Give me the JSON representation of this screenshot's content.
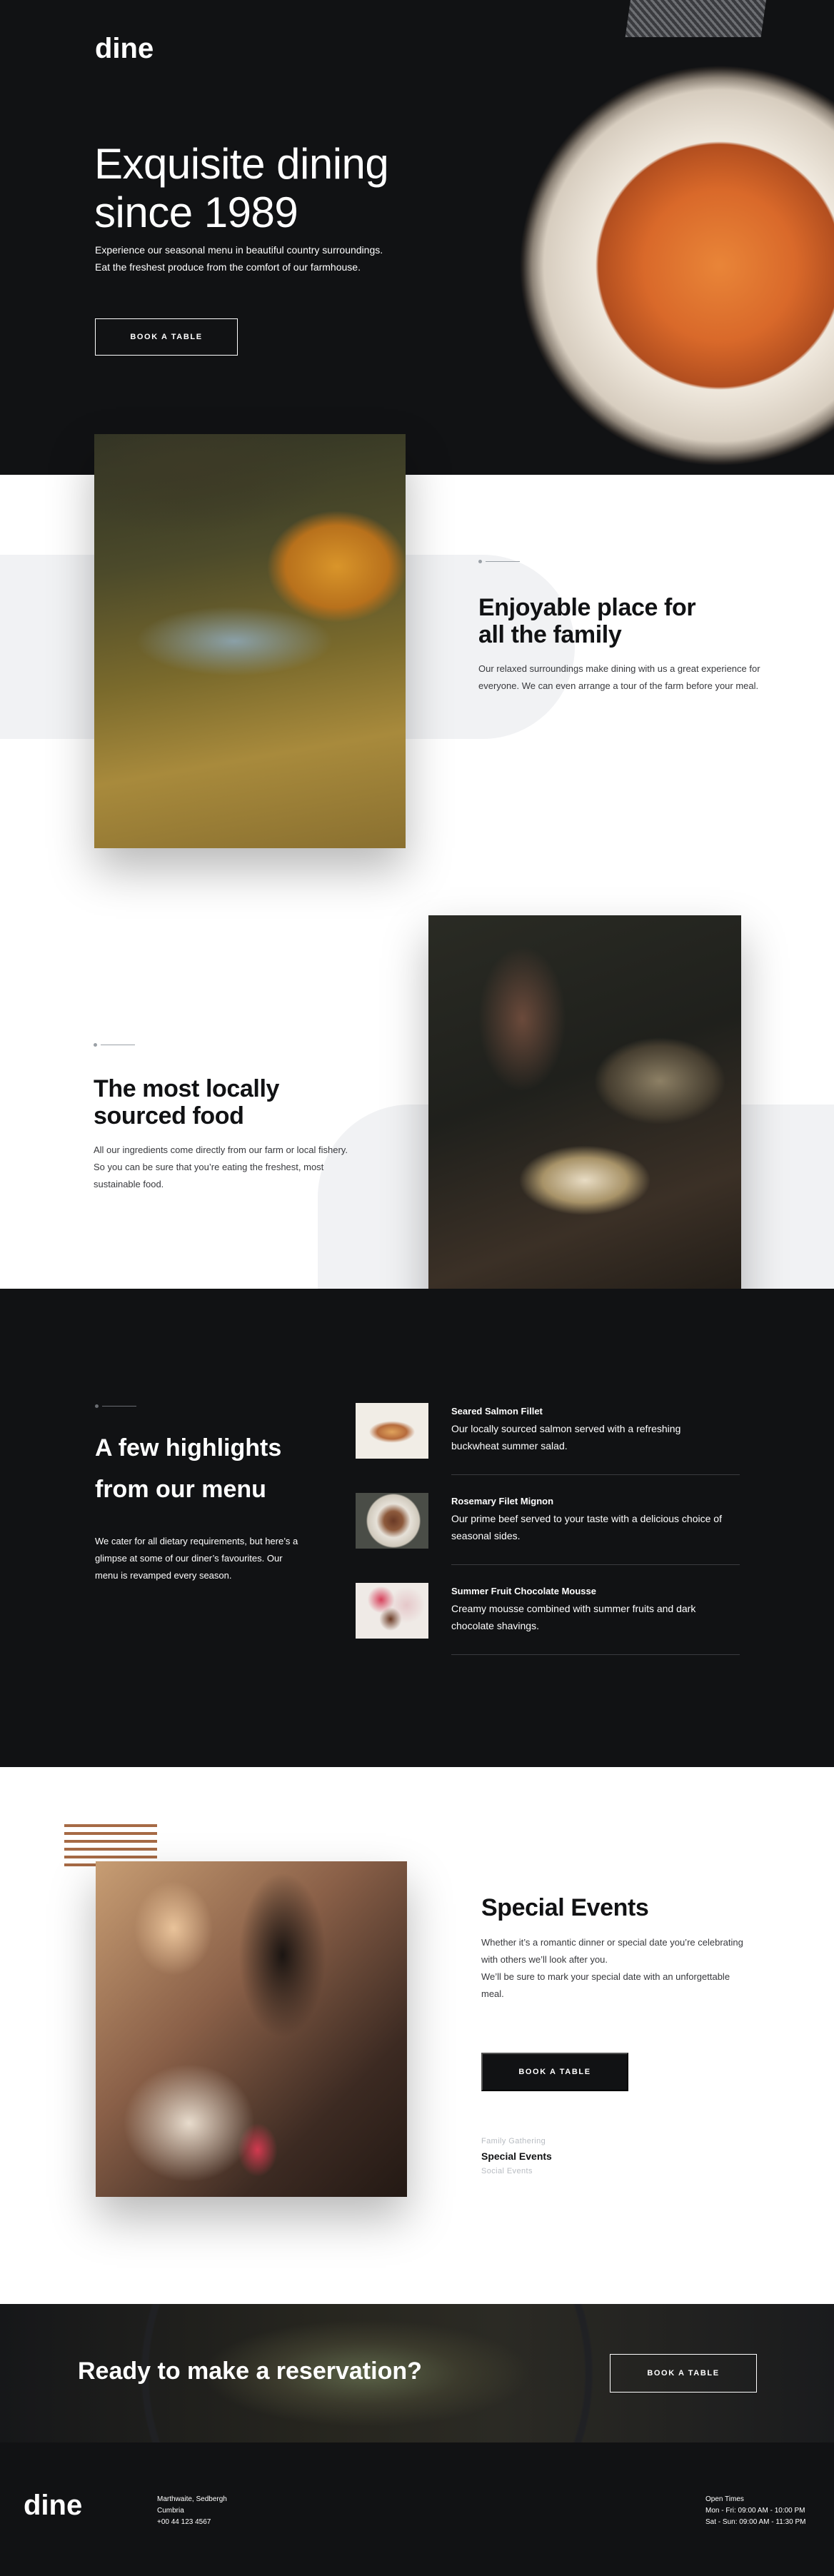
{
  "brand": {
    "logo": "dine"
  },
  "hero": {
    "title_line1": "Exquisite dining",
    "title_line2": "since 1989",
    "text": "Experience our seasonal menu in beautiful country surroundings. Eat the freshest produce from the comfort of our farmhouse.",
    "cta": "BOOK A TABLE"
  },
  "features": [
    {
      "title_line1": "Enjoyable place for",
      "title_line2": "all the family",
      "text": "Our relaxed surroundings make dining with us a great experience for everyone. We can even arrange a tour of the farm before your meal."
    },
    {
      "title_line1": "The most locally",
      "title_line2": "sourced food",
      "text": "All our ingredients come directly from our farm or local fishery. So you can be sure that you’re eating the freshest, most sustainable food."
    }
  ],
  "menu": {
    "title_line1": "A few highlights",
    "title_line2": "from our menu",
    "text": "We cater for all dietary requirements, but here’s a glimpse at some of our diner’s favourites. Our menu is revamped every season.",
    "items": [
      {
        "title": "Seared Salmon Fillet",
        "desc": "Our locally sourced salmon served with a refreshing buckwheat summer salad."
      },
      {
        "title": "Rosemary Filet Mignon",
        "desc": "Our prime beef served to your taste with a delicious choice of seasonal sides."
      },
      {
        "title": "Summer Fruit Chocolate Mousse",
        "desc": "Creamy mousse combined with summer fruits and dark chocolate shavings."
      }
    ]
  },
  "events": {
    "title": "Special Events",
    "text1": "Whether it’s a romantic dinner or special date you’re celebrating with others we’ll look after you.",
    "text2": "We’ll be sure to mark your special date with an unforgettable meal.",
    "cta": "BOOK A TABLE",
    "tabs": [
      "Family Gathering",
      "Special Events",
      "Social Events"
    ]
  },
  "cta": {
    "title": "Ready to make a reservation?",
    "button": "BOOK A TABLE"
  },
  "footer": {
    "logo": "dine",
    "address": [
      "Marthwaite, Sedbergh",
      "Cumbria",
      "+00 44 123 4567"
    ],
    "hours": [
      "Open Times",
      "Mon - Fri: 09:00 AM - 10:00 PM",
      "Sat - Sun: 09:00 AM - 11:30 PM"
    ]
  }
}
